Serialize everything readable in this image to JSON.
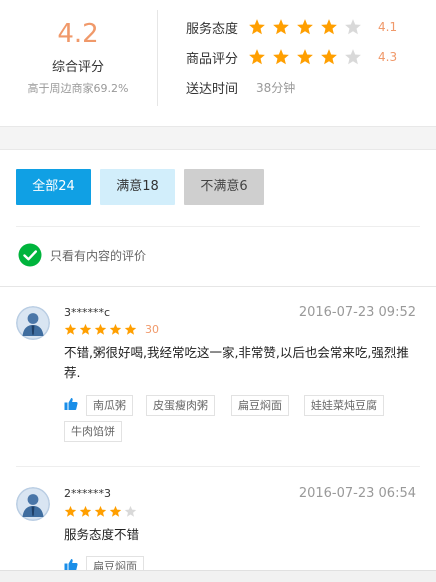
{
  "summary": {
    "overall_score": "4.2",
    "overall_label": "综合评分",
    "compare_text": "高于周边商家69.2%",
    "rows": [
      {
        "label": "服务态度",
        "value": "4.1",
        "stars": 4
      },
      {
        "label": "商品评分",
        "value": "4.3",
        "stars": 4
      },
      {
        "label": "送达时间",
        "text": "38分钟"
      }
    ]
  },
  "filters": {
    "all": "全部24",
    "satisfied": "满意18",
    "unsatisfied": "不满意6",
    "only_content_label": "只看有内容的评价"
  },
  "reviews": [
    {
      "user": "3******c",
      "date": "2016-07-23 09:52",
      "stars": 5,
      "score": "30",
      "content": "不错,粥很好喝,我经常吃这一家,非常赞,以后也会常来吃,强烈推荐.",
      "tags": [
        "南瓜粥",
        "皮蛋瘦肉粥",
        "扁豆焖面",
        "娃娃菜炖豆腐",
        "牛肉馅饼"
      ]
    },
    {
      "user": "2******3",
      "date": "2016-07-23 06:54",
      "stars": 4,
      "content": "服务态度不错",
      "tags": [
        "扁豆焖面"
      ]
    }
  ],
  "colors": {
    "accent_orange": "#f0996a",
    "star_yellow": "#ff9f00",
    "star_gray": "#d9d9d9",
    "tab_active": "#10a0e4",
    "tab_satisfied": "#d2eefb",
    "tab_unsatisfied": "#cfcfcf",
    "check_green": "#00b43c",
    "thumb_blue": "#1a8ee8"
  },
  "icons": [
    "star-icon",
    "check-circle-icon",
    "thumb-up-icon",
    "user-avatar-icon"
  ]
}
